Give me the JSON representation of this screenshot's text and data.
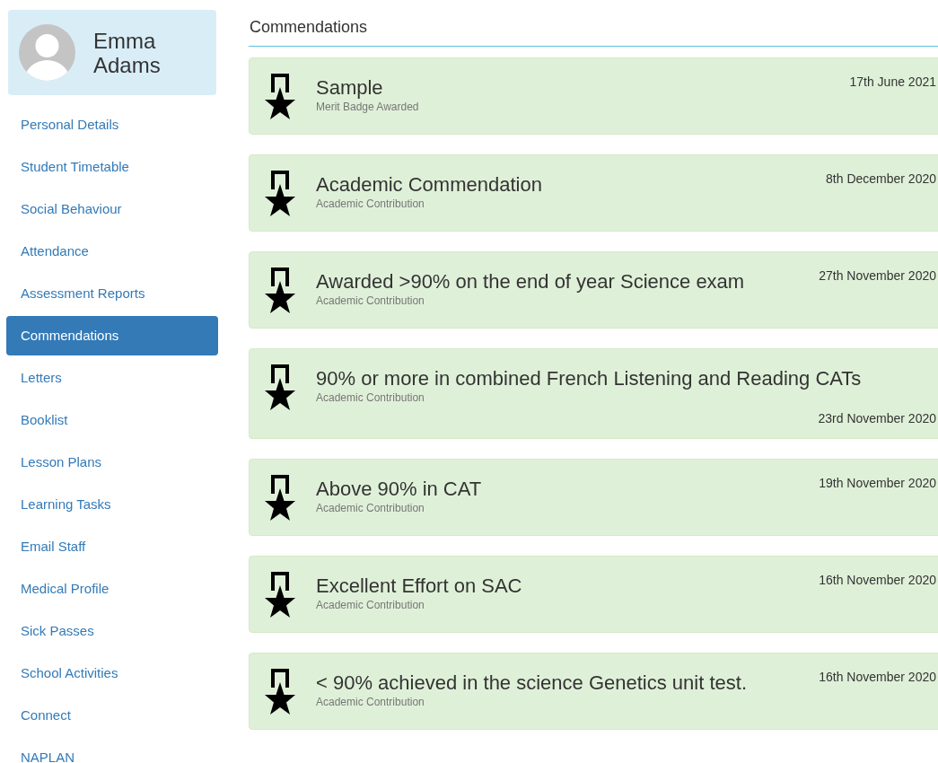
{
  "profile": {
    "name": "Emma Adams"
  },
  "sidebar": {
    "items": [
      {
        "label": "Personal Details",
        "selected": false
      },
      {
        "label": "Student Timetable",
        "selected": false
      },
      {
        "label": "Social Behaviour",
        "selected": false
      },
      {
        "label": "Attendance",
        "selected": false
      },
      {
        "label": "Assessment Reports",
        "selected": false
      },
      {
        "label": "Commendations",
        "selected": true
      },
      {
        "label": "Letters",
        "selected": false
      },
      {
        "label": "Booklist",
        "selected": false
      },
      {
        "label": "Lesson Plans",
        "selected": false
      },
      {
        "label": "Learning Tasks",
        "selected": false
      },
      {
        "label": "Email Staff",
        "selected": false
      },
      {
        "label": "Medical Profile",
        "selected": false
      },
      {
        "label": "Sick Passes",
        "selected": false
      },
      {
        "label": "School Activities",
        "selected": false
      },
      {
        "label": "Connect",
        "selected": false
      },
      {
        "label": "NAPLAN",
        "selected": false
      }
    ]
  },
  "main": {
    "heading": "Commendations",
    "commendations": [
      {
        "title": "Sample",
        "category": "Merit Badge Awarded",
        "date": "17th June 2021"
      },
      {
        "title": "Academic Commendation",
        "category": "Academic Contribution",
        "date": "8th December 2020"
      },
      {
        "title": "Awarded >90% on the end of year Science exam",
        "category": "Academic Contribution",
        "date": "27th November 2020"
      },
      {
        "title": "90% or more in combined French Listening and Reading CATs",
        "category": "Academic Contribution",
        "date": "23rd November 2020"
      },
      {
        "title": "Above 90% in CAT",
        "category": "Academic Contribution",
        "date": "19th November 2020"
      },
      {
        "title": "Excellent Effort on SAC",
        "category": "Academic Contribution",
        "date": "16th November 2020"
      },
      {
        "title": "< 90% achieved in the science Genetics unit test.",
        "category": "Academic Contribution",
        "date": "16th November 2020"
      }
    ]
  }
}
